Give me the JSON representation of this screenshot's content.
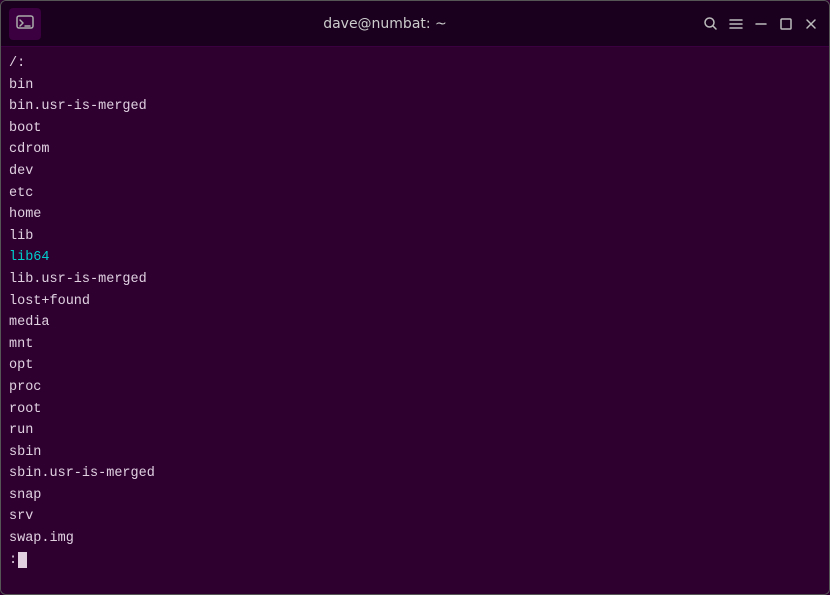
{
  "titlebar": {
    "title": "dave@numbat: ~",
    "icon_label": "terminal-icon"
  },
  "buttons": {
    "search": "🔍",
    "menu": "☰",
    "minimize": "−",
    "maximize": "□",
    "close": "✕"
  },
  "terminal": {
    "lines": [
      {
        "text": "/:",
        "style": "normal"
      },
      {
        "text": "bin",
        "style": "normal"
      },
      {
        "text": "bin.usr-is-merged",
        "style": "normal"
      },
      {
        "text": "boot",
        "style": "normal"
      },
      {
        "text": "cdrom",
        "style": "normal"
      },
      {
        "text": "dev",
        "style": "normal"
      },
      {
        "text": "etc",
        "style": "normal"
      },
      {
        "text": "home",
        "style": "normal"
      },
      {
        "text": "lib",
        "style": "normal"
      },
      {
        "text": "lib64",
        "style": "cyan"
      },
      {
        "text": "lib.usr-is-merged",
        "style": "normal"
      },
      {
        "text": "lost+found",
        "style": "normal"
      },
      {
        "text": "media",
        "style": "normal"
      },
      {
        "text": "mnt",
        "style": "normal"
      },
      {
        "text": "opt",
        "style": "normal"
      },
      {
        "text": "proc",
        "style": "normal"
      },
      {
        "text": "root",
        "style": "normal"
      },
      {
        "text": "run",
        "style": "normal"
      },
      {
        "text": "sbin",
        "style": "normal"
      },
      {
        "text": "sbin.usr-is-merged",
        "style": "normal"
      },
      {
        "text": "snap",
        "style": "normal"
      },
      {
        "text": "srv",
        "style": "normal"
      },
      {
        "text": "swap.img",
        "style": "normal"
      }
    ],
    "prompt_prefix": ":"
  }
}
